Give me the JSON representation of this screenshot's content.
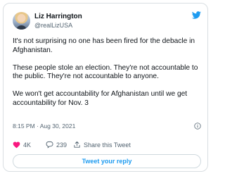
{
  "tweet": {
    "author_name": "Liz Harrington",
    "handle": "@realLizUSA",
    "paragraphs": [
      "It's not surprising no one has been fired for the debacle in Afghanistan.",
      "These people stole an election. They're not accountable to the public. They're not accountable to anyone.",
      "We won't get accountability for Afghanistan until we get accountability for Nov. 3"
    ],
    "timestamp": "8:15 PM · Aug 30, 2021"
  },
  "actions": {
    "likes": "4K",
    "replies": "239",
    "share_label": "Share this Tweet"
  },
  "reply_button": {
    "label": "Tweet your reply"
  },
  "colors": {
    "accent": "#1d9bf0",
    "like": "#f91880",
    "text": "#0f1419",
    "muted": "#536471",
    "border": "#d9dee2"
  },
  "icons": {
    "brand": "twitter-bird-icon",
    "info": "info-icon",
    "like": "heart-icon",
    "reply": "reply-bubble-icon",
    "share": "share-icon"
  }
}
